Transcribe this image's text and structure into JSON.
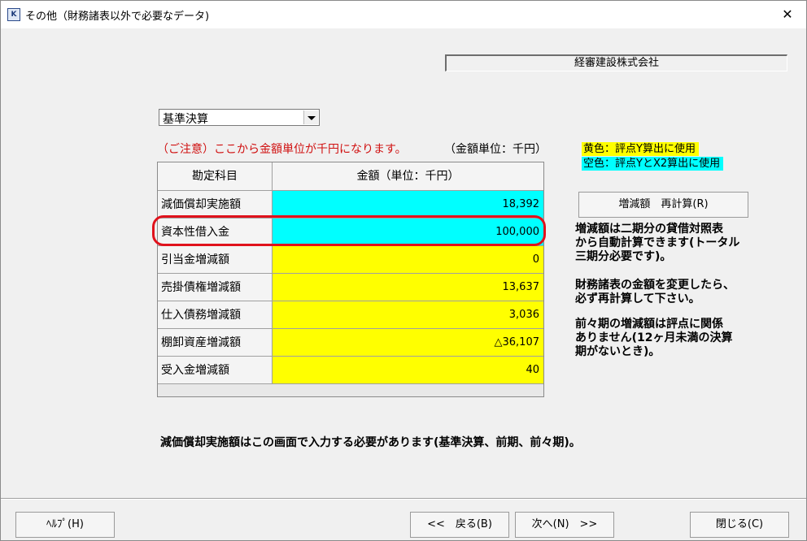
{
  "window": {
    "title": "その他（財務諸表以外で必要なデータ)",
    "close_glyph": "✕",
    "icon_label": "K"
  },
  "company_name": "経審建設株式会社",
  "period_select": {
    "value": "基準決算"
  },
  "notice": "（ご注意）ここから金額単位が千円になります。",
  "unit_label": "（金額単位：千円）",
  "legend": {
    "yellow": "黄色：評点Y算出に使用",
    "cyan": "空色：評点YとX2算出に使用",
    "yellow_color": "#ffff00",
    "cyan_color": "#00ffff"
  },
  "table": {
    "headers": [
      "勘定科目",
      "金額（単位：千円）"
    ],
    "rows": [
      {
        "label": "減価償却実施額",
        "value": "18,392",
        "color": "cyan"
      },
      {
        "label": "資本性借入金",
        "value": "100,000",
        "color": "cyan"
      },
      {
        "label": "引当金増減額",
        "value": "0",
        "color": "yellow"
      },
      {
        "label": "売掛債権増減額",
        "value": "13,637",
        "color": "yellow"
      },
      {
        "label": "仕入債務増減額",
        "value": "3,036",
        "color": "yellow"
      },
      {
        "label": "棚卸資産増減額",
        "value": "△36,107",
        "color": "yellow"
      },
      {
        "label": "受入金増減額",
        "value": "40",
        "color": "yellow"
      }
    ]
  },
  "recalc_button": "増減額　再計算(R)",
  "info": {
    "p1_line1": "増減額は二期分の貸借対照表",
    "p1_line2": "から自動計算できます(トータル",
    "p1_line3": "三期分必要です)。",
    "p2_line1": "財務諸表の金額を変更したら、",
    "p2_line2": "必ず再計算して下さい。",
    "p3_line1": "前々期の増減額は評点に関係",
    "p3_line2": "ありません(12ヶ月未満の決算",
    "p3_line3": "期がないとき)。"
  },
  "bottom_note": "減価償却実施額はこの画面で入力する必要があります(基準決算、前期、前々期)。",
  "buttons": {
    "help": "ﾍﾙﾌﾟ(H)",
    "back": "<<　戻る(B)",
    "next": "次へ(N)　>>",
    "close": "閉じる(C)"
  }
}
